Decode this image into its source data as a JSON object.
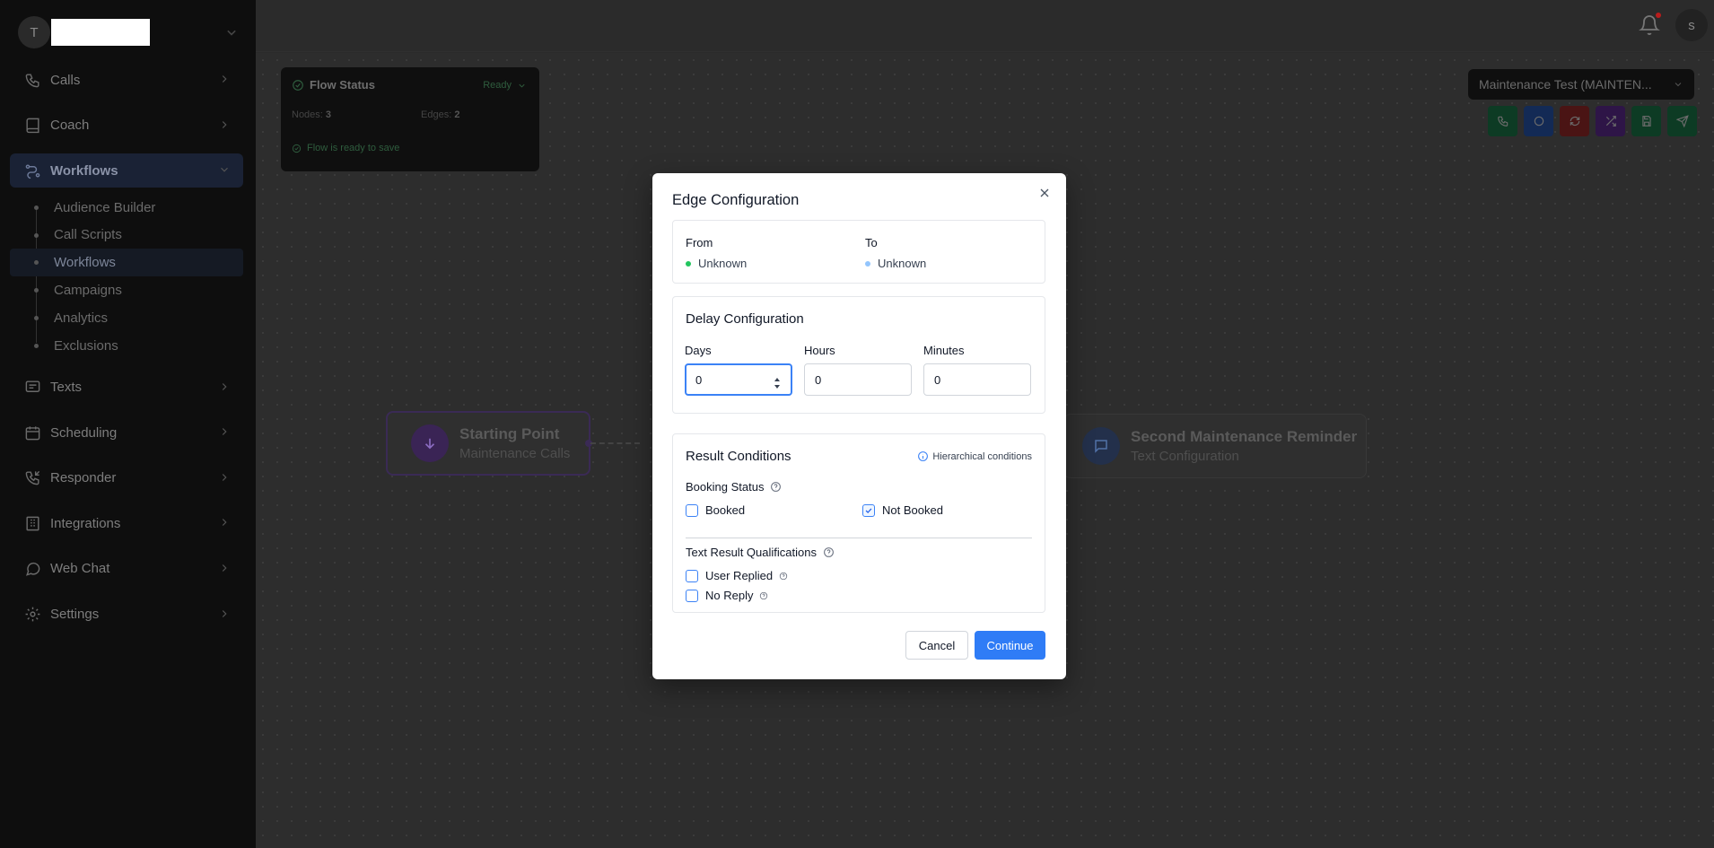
{
  "workspace": {
    "avatar_letter": "T"
  },
  "sidebar": {
    "items": [
      {
        "label": "Calls",
        "icon": "phone-icon"
      },
      {
        "label": "Coach",
        "icon": "book-icon"
      },
      {
        "label": "Workflows",
        "icon": "workflow-icon",
        "active": true,
        "children": [
          {
            "label": "Audience Builder"
          },
          {
            "label": "Call Scripts"
          },
          {
            "label": "Workflows",
            "active": true
          },
          {
            "label": "Campaigns"
          },
          {
            "label": "Analytics"
          },
          {
            "label": "Exclusions"
          }
        ]
      },
      {
        "label": "Texts",
        "icon": "message-icon"
      },
      {
        "label": "Scheduling",
        "icon": "calendar-icon"
      },
      {
        "label": "Responder",
        "icon": "phone-incoming-icon"
      },
      {
        "label": "Integrations",
        "icon": "building-icon"
      },
      {
        "label": "Web Chat",
        "icon": "chat-bubble-icon"
      },
      {
        "label": "Settings",
        "icon": "gear-icon"
      }
    ]
  },
  "header": {
    "user_initial": "s"
  },
  "flow_status": {
    "title": "Flow Status",
    "status": "Ready",
    "nodes_label": "Nodes:",
    "nodes_count": "3",
    "edges_label": "Edges:",
    "edges_count": "2",
    "message": "Flow is ready to save"
  },
  "campaign_select": {
    "value": "Maintenance Test (MAINTEN..."
  },
  "toolbar": {
    "buttons": [
      {
        "icon": "phone-icon",
        "color": "#0d3b24"
      },
      {
        "icon": "circle-icon",
        "color": "#132a55"
      },
      {
        "icon": "refresh-icon",
        "color": "#4a1414"
      },
      {
        "icon": "shuffle-icon",
        "color": "#2e1547"
      },
      {
        "icon": "save-icon",
        "color": "#0d3b24"
      },
      {
        "icon": "send-icon",
        "color": "#0d3b24"
      }
    ]
  },
  "canvas": {
    "start_node": {
      "title": "Starting Point",
      "subtitle": "Maintenance Calls"
    },
    "second_node": {
      "title": "Second Maintenance Reminder",
      "subtitle": "Text Configuration"
    }
  },
  "modal": {
    "title": "Edge Configuration",
    "from_label": "From",
    "from_value": "Unknown",
    "from_color": "#22c55e",
    "to_label": "To",
    "to_value": "Unknown",
    "to_color": "#93c5fd",
    "delay": {
      "title": "Delay Configuration",
      "days_label": "Days",
      "days_value": "0",
      "hours_label": "Hours",
      "hours_value": "0",
      "minutes_label": "Minutes",
      "minutes_value": "0"
    },
    "result": {
      "title": "Result Conditions",
      "hierarchical_label": "Hierarchical conditions",
      "booking_status_label": "Booking Status",
      "booked_label": "Booked",
      "booked_checked": false,
      "not_booked_label": "Not Booked",
      "not_booked_checked": true,
      "text_result_label": "Text Result Qualifications",
      "user_replied_label": "User Replied",
      "user_replied_checked": false,
      "no_reply_label": "No Reply",
      "no_reply_checked": false
    },
    "cancel_label": "Cancel",
    "continue_label": "Continue",
    "accent_color": "#2f7cf6"
  }
}
